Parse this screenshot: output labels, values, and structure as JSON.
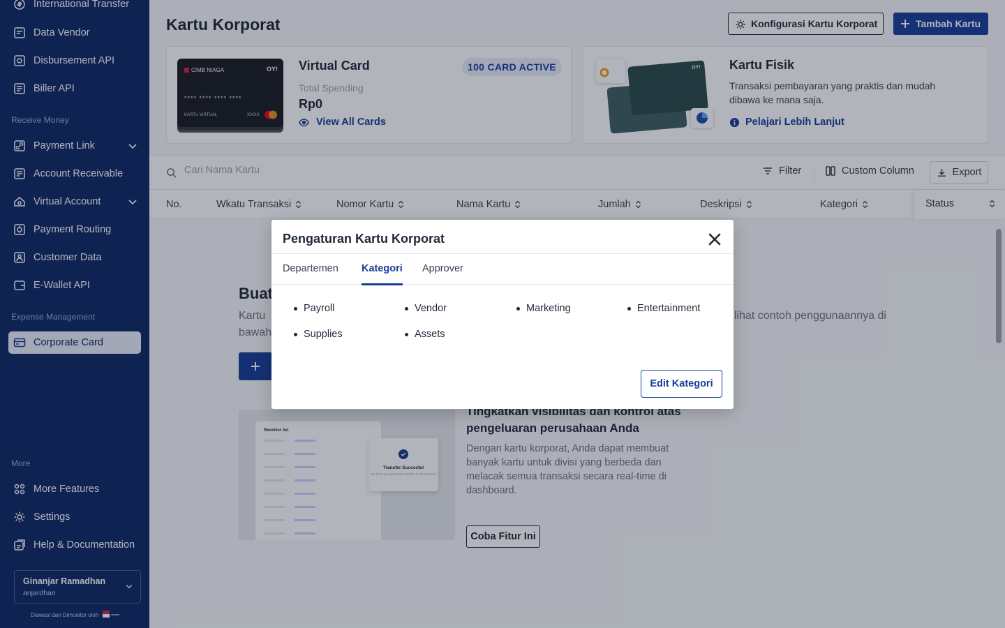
{
  "sidebar": {
    "items": [
      {
        "label": "International Transfer"
      },
      {
        "label": "Data Vendor"
      },
      {
        "label": "Disbursement API"
      },
      {
        "label": "Biller API"
      },
      {
        "label": "Payment Link"
      },
      {
        "label": "Account Receivable"
      },
      {
        "label": "Virtual Account"
      },
      {
        "label": "Payment Routing"
      },
      {
        "label": "Customer Data"
      },
      {
        "label": "E-Wallet API"
      },
      {
        "label": "Corporate Card"
      },
      {
        "label": "More Features"
      },
      {
        "label": "Settings"
      },
      {
        "label": "Help & Documentation"
      }
    ],
    "sections": {
      "receive_money": "Receive Money",
      "expense_management": "Expense Management",
      "more": "More"
    },
    "user": {
      "name": "Ginanjar Ramadhan",
      "handle": "anjardhan"
    },
    "supervised_label": "Diawasi dan Dimonitor oleh"
  },
  "header": {
    "title": "Kartu Korporat",
    "config_button": "Konfigurasi Kartu Korporat",
    "add_button": "Tambah Kartu"
  },
  "virtual_card": {
    "title": "Virtual Card",
    "badge": "100 CARD ACTIVE",
    "spend_label": "Total Spending",
    "spend_value": "Rp0",
    "link": "View All Cards",
    "card_bank": "CIMB NIAGA",
    "card_brand": "OY!",
    "card_number": "**** **** **** ****",
    "card_type": "KARTU VIRTUAL",
    "card_exp": "XX/XX"
  },
  "physical_card": {
    "title": "Kartu Fisik",
    "description": "Transaksi pembayaran yang praktis dan mudah dibawa ke mana saja.",
    "link": "Pelajari Lebih Lanjut"
  },
  "toolbar": {
    "search_placeholder": "Cari Nama Kartu",
    "filter": "Filter",
    "custom_column": "Custom Column",
    "export": "Export"
  },
  "table": {
    "columns": [
      "No.",
      "Wkatu Transaksi",
      "Nomor Kartu",
      "Nama Kartu",
      "Jumlah",
      "Deskripsi",
      "Kategori",
      "Status"
    ]
  },
  "empty_state": {
    "title": "Buat",
    "desc_1": "Kartu",
    "desc_tail": "lihat contoh penggunaannya di",
    "desc_2": "bawah"
  },
  "promo": {
    "title": "Tingkatkan visibilitas dan kontrol atas pengeluaran perusahaan Anda",
    "description": "Dengan kartu korporat, Anda dapat membuat banyak kartu untuk divisi yang berbeda dan melacak semua transaksi secara real-time di dashboard.",
    "button": "Coba Fitur Ini",
    "mock_title": "Receiver list",
    "mock_toast_title": "Transfer Succesful",
    "mock_toast_sub": "We have processed the transfer to 10 receivers"
  },
  "modal": {
    "title": "Pengaturan Kartu Korporat",
    "tabs": [
      {
        "label": "Departemen"
      },
      {
        "label": "Kategori"
      },
      {
        "label": "Approver"
      }
    ],
    "active_tab": "Kategori",
    "categories": [
      "Payroll",
      "Vendor",
      "Marketing",
      "Entertainment",
      "Supplies",
      "Assets"
    ],
    "edit_button": "Edit Kategori"
  },
  "colors": {
    "sidebar_bg": "#0f2a66",
    "primary": "#173f99",
    "active_item_bg": "#e8edf8"
  }
}
